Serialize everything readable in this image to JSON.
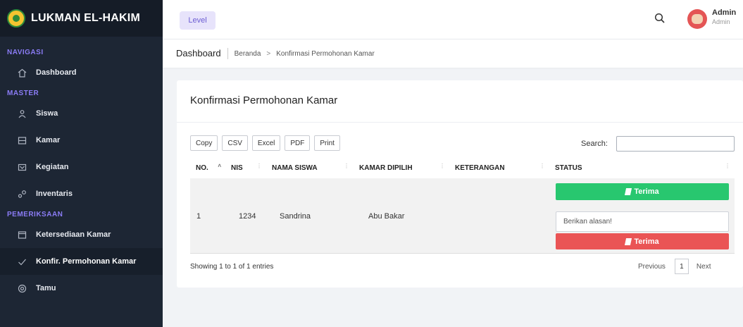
{
  "app": {
    "brand": "LUKMAN EL-HAKIM"
  },
  "sidebar": {
    "sections": [
      {
        "title": "NAVIGASI",
        "items": [
          {
            "label": "Dashboard",
            "icon": "home-icon"
          }
        ]
      },
      {
        "title": "MASTER",
        "items": [
          {
            "label": "Siswa",
            "icon": "user-icon"
          },
          {
            "label": "Kamar",
            "icon": "room-icon"
          },
          {
            "label": "Kegiatan",
            "icon": "activity-icon"
          },
          {
            "label": "Inventaris",
            "icon": "inventory-icon"
          }
        ]
      },
      {
        "title": "PEMERIKSAAN",
        "items": [
          {
            "label": "Ketersediaan Kamar",
            "icon": "availability-icon"
          },
          {
            "label": "Konfir. Permohonan Kamar",
            "icon": "check-icon",
            "active": true
          },
          {
            "label": "Tamu",
            "icon": "guest-icon"
          }
        ]
      }
    ]
  },
  "topbar": {
    "level_label": "Level",
    "user_name": "Admin",
    "user_role": "Admin"
  },
  "breadcrumb": {
    "title": "Dashboard",
    "home": "Beranda",
    "separator": ">",
    "current": "Konfirmasi Permohonan Kamar"
  },
  "card": {
    "title": "Konfirmasi Permohonan Kamar",
    "export_buttons": [
      "Copy",
      "CSV",
      "Excel",
      "PDF",
      "Print"
    ],
    "search_label": "Search:",
    "columns": [
      "NO.",
      "NIS",
      "NAMA SISWA",
      "KAMAR DIPILIH",
      "KETERANGAN",
      "STATUS"
    ],
    "rows": [
      {
        "no": "1",
        "nis": "1234",
        "nama": "Sandrina",
        "kamar": "Abu Bakar",
        "keterangan": ""
      }
    ],
    "accept_label": "Terima",
    "reason_placeholder": "Berikan alasan!",
    "reject_label": "Terima",
    "info": "Showing 1 to 1 of 1 entries",
    "pager": {
      "previous": "Previous",
      "page": "1",
      "next": "Next"
    }
  },
  "colors": {
    "accept": "#28c76f",
    "reject": "#ea5455",
    "accent": "#6c5dd3",
    "sidebar": "#1d2634"
  }
}
